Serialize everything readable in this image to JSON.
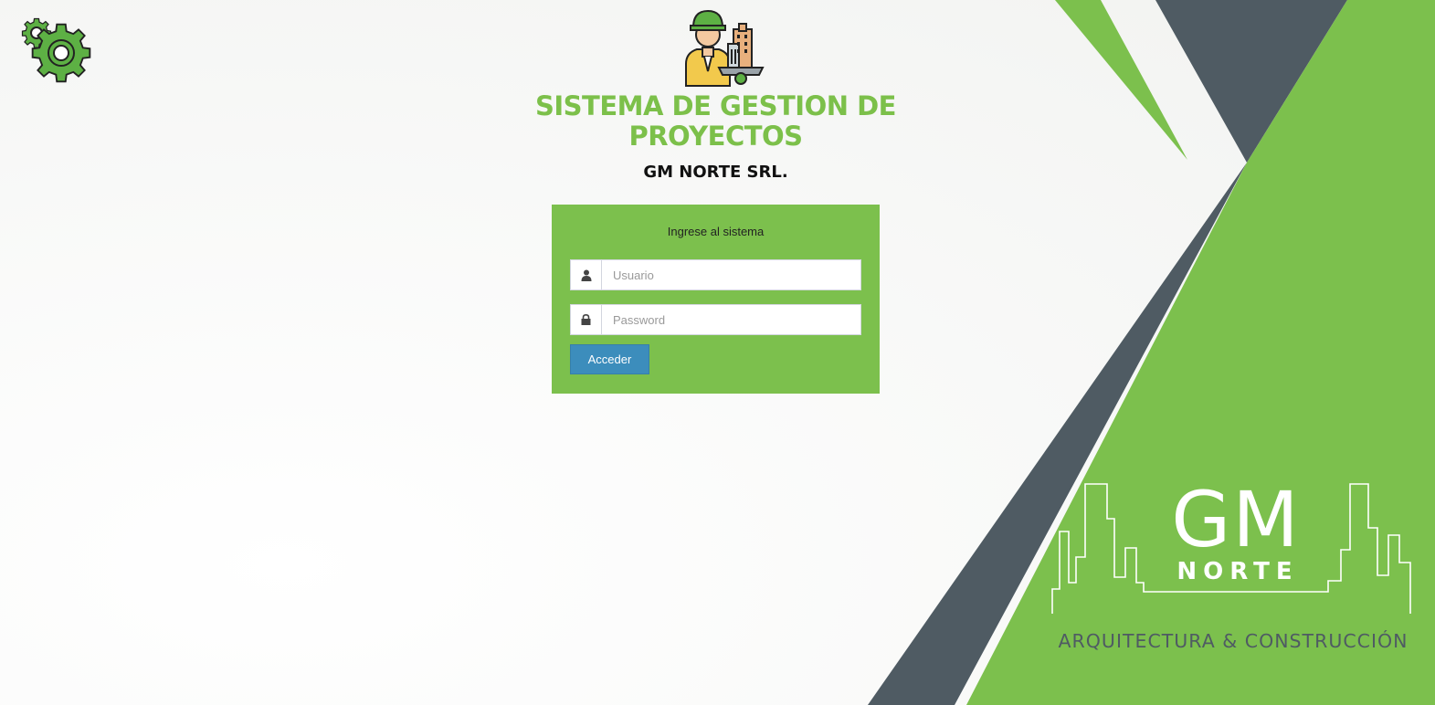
{
  "app": {
    "title": "SISTEMA DE GESTION DE PROYECTOS",
    "company": "GM NORTE SRL."
  },
  "login": {
    "message": "Ingrese al sistema",
    "username_placeholder": "Usuario",
    "username_value": "",
    "password_placeholder": "Password",
    "password_value": "",
    "submit_label": "Acceder"
  },
  "brand": {
    "logo_main": "GM",
    "logo_sub": "NORTE",
    "tagline": "ARQUITECTURA & CONSTRUCCIÓN"
  },
  "icons": {
    "settings": "gears-icon",
    "hero": "construction-worker-icon",
    "user": "user-icon",
    "password": "lock-icon"
  },
  "colors": {
    "accent_green": "#7cc04a",
    "dark_slate": "#4f5b63",
    "button_blue": "#3c8dbc"
  }
}
